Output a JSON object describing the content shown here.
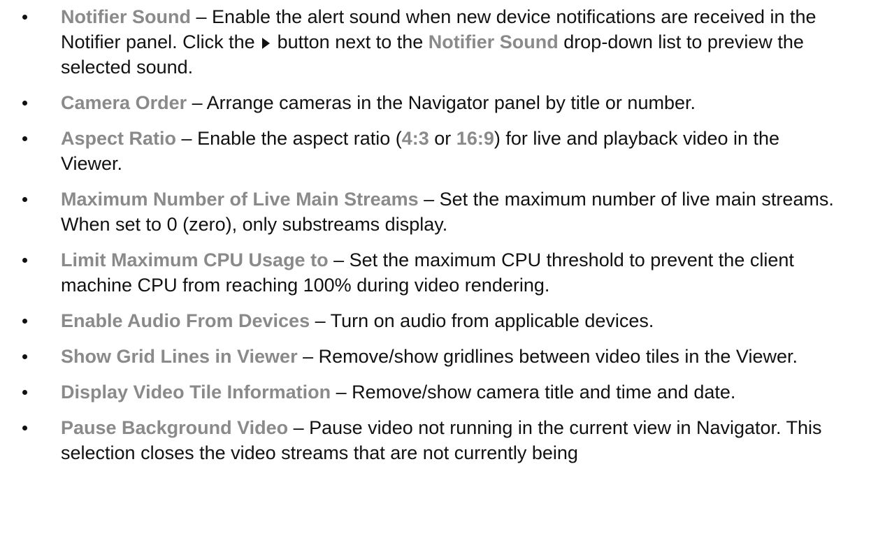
{
  "items": [
    {
      "term": "Notifier Sound",
      "text_a": " – Enable the alert sound when new device notifications are received in the Notifier panel. Click the ",
      "icon": "play-icon",
      "text_b": " button next to the ",
      "term_b": "Notifier Sound",
      "text_c": " drop-down list to preview the selected sound."
    },
    {
      "term": "Camera Order",
      "text": " – Arrange cameras in the Navigator panel by title or number."
    },
    {
      "term": "Aspect Ratio",
      "text_a": " – Enable the aspect ratio (",
      "term_b": "4:3",
      "text_b": " or ",
      "term_c": "16:9",
      "text_c": ") for live and playback video in the Viewer."
    },
    {
      "term": "Maximum Number of Live Main Streams",
      "text": " – Set the maximum number of live main streams. When set to 0 (zero), only substreams display."
    },
    {
      "term": "Limit Maximum CPU Usage to",
      "text": " – Set the maximum CPU threshold to prevent the client machine CPU from reaching 100% during video rendering."
    },
    {
      "term": "Enable Audio From Devices",
      "text": " – Turn on audio from applicable devices."
    },
    {
      "term": "Show Grid Lines in Viewer",
      "text": " – Remove/show gridlines between video tiles in the Viewer."
    },
    {
      "term": "Display Video Tile Information",
      "text": " – Remove/show camera title and time and date."
    },
    {
      "term": "Pause Background Video",
      "text": " – Pause video not running in the current view in Navigator. This selection closes the video streams that are not currently being"
    }
  ],
  "colors": {
    "term": "#8a8a8a",
    "body_text": "#111111"
  }
}
